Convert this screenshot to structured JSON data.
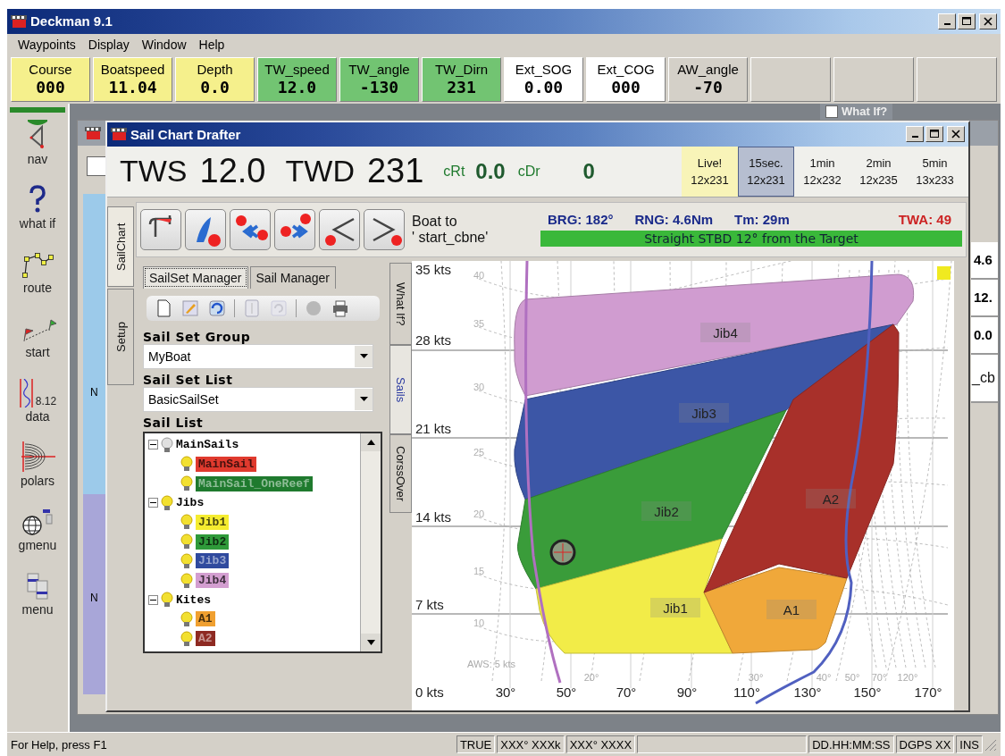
{
  "window": {
    "title": "Deckman 9.1"
  },
  "menu": [
    "Waypoints",
    "Display",
    "Window",
    "Help"
  ],
  "instruments": [
    {
      "label": "Course",
      "value": "000",
      "color": "#f5f08c"
    },
    {
      "label": "Boatspeed",
      "value": "11.04",
      "color": "#f5f08c"
    },
    {
      "label": "Depth",
      "value": "0.0",
      "color": "#f5f08c"
    },
    {
      "label": "TW_speed",
      "value": "12.0",
      "color": "#72c472"
    },
    {
      "label": "TW_angle",
      "value": "-130",
      "color": "#72c472"
    },
    {
      "label": "TW_Dirn",
      "value": "231",
      "color": "#72c472"
    },
    {
      "label": "Ext_SOG",
      "value": "0.00",
      "color": "#ffffff"
    },
    {
      "label": "Ext_COG",
      "value": "000",
      "color": "#ffffff"
    },
    {
      "label": "AW_angle",
      "value": "-70",
      "color": "#d4d0c8"
    }
  ],
  "sidebar": [
    {
      "label": "nav",
      "selected": true
    },
    {
      "label": "what if",
      "selected": false
    },
    {
      "label": "route",
      "selected": false
    },
    {
      "label": "start",
      "selected": false
    },
    {
      "label": "data",
      "selected": false,
      "icon_text": "8.12"
    },
    {
      "label": "polars",
      "selected": false
    },
    {
      "label": "gmenu",
      "selected": false
    },
    {
      "label": "menu",
      "selected": false
    }
  ],
  "background_window": {
    "what_if": "What If?",
    "what_if_checked": false,
    "map_marks": [
      "N",
      "N"
    ],
    "readouts": [
      "4.6",
      "12.",
      "0.0",
      "_cb"
    ]
  },
  "drafter": {
    "title": "Sail Chart Drafter",
    "readout": {
      "tws_label": "TWS",
      "tws": "12.0",
      "twd_label": "TWD",
      "twd": "231",
      "crt_label": "cRt",
      "crt": "0.0",
      "cdr_label": "cDr",
      "cdr": "0"
    },
    "periods": [
      {
        "label": "Live!",
        "value": "12x231",
        "kind": "live",
        "selected": false
      },
      {
        "label": "15sec.",
        "value": "12x231",
        "kind": "interval",
        "selected": true
      },
      {
        "label": "1min",
        "value": "12x232",
        "kind": "interval",
        "selected": false
      },
      {
        "label": "2min",
        "value": "12x235",
        "kind": "interval",
        "selected": false
      },
      {
        "label": "5min",
        "value": "13x233",
        "kind": "interval",
        "selected": false
      }
    ],
    "side_tabs": [
      {
        "label": "SailChart",
        "selected": true
      },
      {
        "label": "Setup",
        "selected": false
      }
    ],
    "target": {
      "line_1": "Boat to",
      "line_2": "' start_cbne'",
      "brg": "BRG: 182°",
      "rng": "RNG: 4.6Nm",
      "tm": "Tm: 29m",
      "twa": "TWA: 49",
      "advice": "Straight STBD 12° from the Target"
    },
    "panel_tabs": [
      {
        "label": "SailSet Manager",
        "selected": true
      },
      {
        "label": "Sail Manager",
        "selected": false
      }
    ],
    "tools": [
      {
        "disabled": false
      },
      {
        "disabled": false
      },
      {
        "disabled": false
      },
      {
        "disabled": true
      },
      {
        "disabled": true
      },
      {
        "disabled": true
      },
      {
        "disabled": false
      }
    ],
    "sail_set_group": {
      "label": "Sail Set Group",
      "value": "MyBoat"
    },
    "sail_set_list": {
      "label": "Sail Set List",
      "value": "BasicSailSet"
    },
    "sail_list": {
      "label": "Sail List",
      "groups": [
        {
          "label": "MainSails",
          "lamp_on": false,
          "expanded": true,
          "children": [
            {
              "label": "MainSail",
              "color": "#e03a2e"
            },
            {
              "label": "MainSail_OneReef",
              "color": "#1f7a2e"
            }
          ]
        },
        {
          "label": "Jibs",
          "lamp_on": true,
          "expanded": true,
          "children": [
            {
              "label": "Jib1",
              "color": "#f5ec30"
            },
            {
              "label": "Jib2",
              "color": "#2f9a3a"
            },
            {
              "label": "Jib3",
              "color": "#2f4a9e"
            },
            {
              "label": "Jib4",
              "color": "#d39ed0"
            }
          ]
        },
        {
          "label": "Kites",
          "lamp_on": true,
          "expanded": true,
          "children": [
            {
              "label": "A1",
              "color": "#f0a030"
            },
            {
              "label": "A2",
              "color": "#8e2a22"
            }
          ]
        }
      ]
    },
    "chart_tabs": [
      {
        "label": "What If?",
        "selected": false
      },
      {
        "label": "Sails",
        "selected": true
      },
      {
        "label": "CorssOver",
        "selected": false
      }
    ],
    "sail_chart": {
      "y_labels": [
        "35 kts",
        "28 kts",
        "21 kts",
        "14 kts",
        "7 kts",
        "0 kts"
      ],
      "x_labels": [
        "30°",
        "50°",
        "70°",
        "90°",
        "110°",
        "130°",
        "150°",
        "170°"
      ],
      "aws_labels": [
        "40",
        "35",
        "30",
        "25",
        "20",
        "15",
        "10"
      ],
      "aws_caption": "AWS: 5 kts",
      "awa_labels": [
        "20°",
        "30°",
        "40°",
        "50°",
        "70°",
        "120°"
      ],
      "regions": [
        {
          "label": "Jib4",
          "color": "#d09cd0"
        },
        {
          "label": "Jib3",
          "color": "#3c56a6"
        },
        {
          "label": "Jib2",
          "color": "#3a9c3a"
        },
        {
          "label": "Jib1",
          "color": "#f2ec48"
        },
        {
          "label": "A1",
          "color": "#f0a83a"
        },
        {
          "label": "A2",
          "color": "#a8302a"
        }
      ]
    }
  },
  "status_bar": {
    "help": "For Help, press F1",
    "panes": [
      "TRUE",
      "XXX° XXXk",
      "XXX° XXXX",
      "DD.HH:MM:SS",
      "DGPS XX",
      "INS"
    ]
  }
}
